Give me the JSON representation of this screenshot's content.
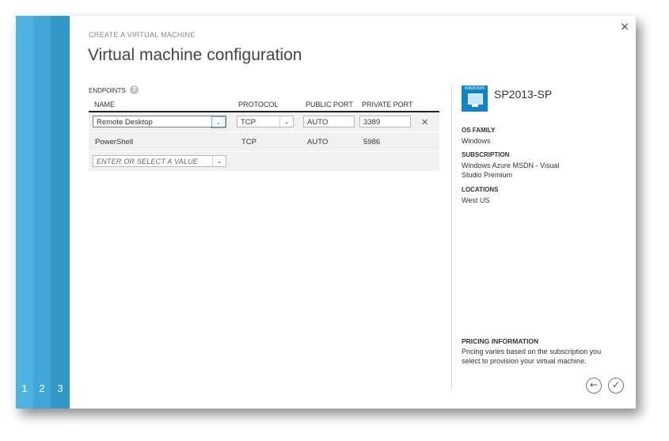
{
  "wizard": {
    "subtitle": "CREATE A VIRTUAL MACHINE",
    "title": "Virtual machine configuration",
    "steps": [
      "1",
      "2",
      "3"
    ],
    "close_glyph": "×"
  },
  "colors": {
    "stripe_1": "#4fb3e0",
    "stripe_2": "#42a6d6",
    "stripe_3": "#3297c4",
    "accent": "#0f85c8"
  },
  "endpoints": {
    "label": "ENDPOINTS",
    "help_icon": "question-circle-icon",
    "help_glyph": "?",
    "columns": [
      "NAME",
      "PROTOCOL",
      "PUBLIC PORT",
      "PRIVATE PORT"
    ],
    "editing_row": {
      "name": "Remote Desktop",
      "protocol": "TCP",
      "public_port": "AUTO",
      "private_port": "3389"
    },
    "rows": [
      {
        "name": "PowerShell",
        "protocol": "TCP",
        "public_port": "AUTO",
        "private_port": "5986"
      }
    ],
    "new_row_placeholder": "ENTER OR SELECT A VALUE",
    "remove_glyph": "✕",
    "dropdown_glyph": "⌄"
  },
  "summary": {
    "os_tile_text": "WINDOWS",
    "vm_name": "SP2013-SP",
    "os_family_label": "OS FAMILY",
    "os_family_value": "Windows",
    "subscription_label": "SUBSCRIPTION",
    "subscription_value": "Windows Azure MSDN - Visual Studio Premium",
    "locations_label": "LOCATIONS",
    "locations_value": "West US",
    "pricing_label": "PRICING INFORMATION",
    "pricing_text": "Pricing varies based on the subscription you select to provision your virtual machine."
  },
  "nav": {
    "back_glyph": "←",
    "complete_glyph": "✓",
    "back_icon": "arrow-left-icon",
    "complete_icon": "checkmark-icon"
  }
}
